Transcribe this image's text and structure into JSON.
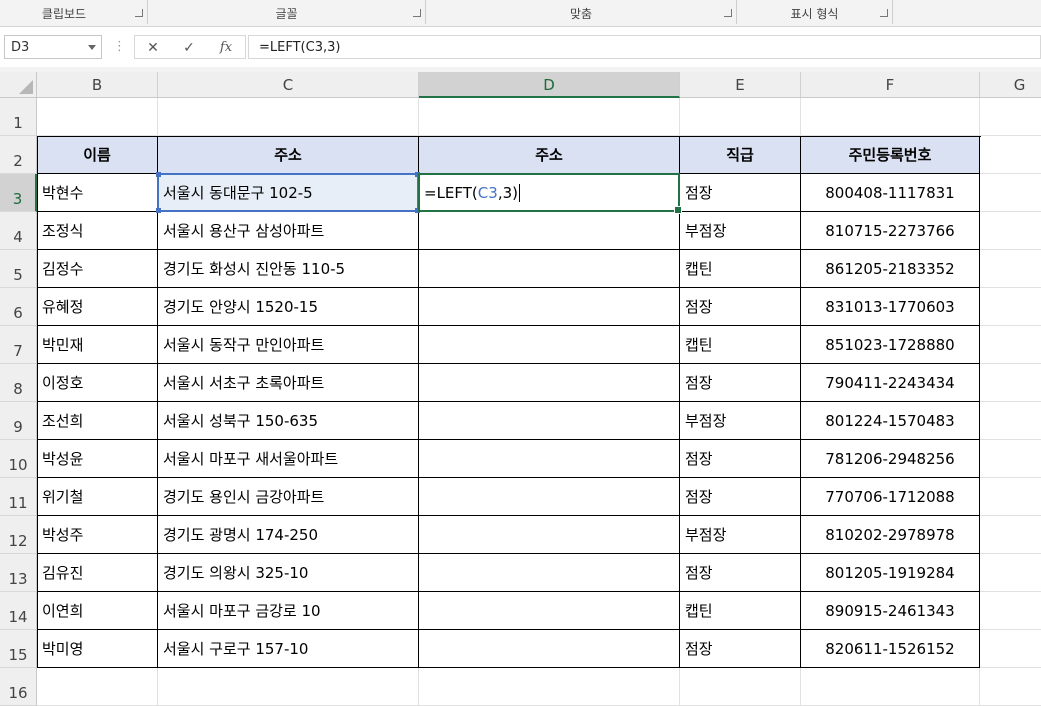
{
  "ribbon": {
    "groups": [
      "클립보드",
      "글꼴",
      "맞춤",
      "표시 형식"
    ]
  },
  "formula_bar": {
    "name_box": "D3",
    "cancel_icon": "✕",
    "enter_icon": "✓",
    "fx_label": "fx",
    "formula": "=LEFT(C3,3)"
  },
  "columns": [
    "B",
    "C",
    "D",
    "E",
    "F",
    "G"
  ],
  "rows": [
    "1",
    "2",
    "3",
    "4",
    "5",
    "6",
    "7",
    "8",
    "9",
    "10",
    "11",
    "12",
    "13",
    "14",
    "15",
    "16"
  ],
  "table": {
    "headers": [
      "이름",
      "주소",
      "주소",
      "직급",
      "주민등록번호"
    ],
    "records": [
      {
        "name": "박현수",
        "address": "서울시 동대문구 102-5",
        "result": "",
        "rank": "점장",
        "id": "800408-1117831"
      },
      {
        "name": "조정식",
        "address": "서울시 용산구 삼성아파트",
        "result": "",
        "rank": "부점장",
        "id": "810715-2273766"
      },
      {
        "name": "김정수",
        "address": "경기도 화성시 진안동 110-5",
        "result": "",
        "rank": "캡틴",
        "id": "861205-2183352"
      },
      {
        "name": "유혜정",
        "address": "경기도 안양시 1520-15",
        "result": "",
        "rank": "점장",
        "id": "831013-1770603"
      },
      {
        "name": "박민재",
        "address": "서울시 동작구 만인아파트",
        "result": "",
        "rank": "캡틴",
        "id": "851023-1728880"
      },
      {
        "name": "이정호",
        "address": "서울시 서초구 초록아파트",
        "result": "",
        "rank": "점장",
        "id": "790411-2243434"
      },
      {
        "name": "조선희",
        "address": "서울시 성북구 150-635",
        "result": "",
        "rank": "부점장",
        "id": "801224-1570483"
      },
      {
        "name": "박성윤",
        "address": "서울시 마포구 새서울아파트",
        "result": "",
        "rank": "점장",
        "id": "781206-2948256"
      },
      {
        "name": "위기철",
        "address": "경기도 용인시 금강아파트",
        "result": "",
        "rank": "점장",
        "id": "770706-1712088"
      },
      {
        "name": "박성주",
        "address": "경기도 광명시 174-250",
        "result": "",
        "rank": "부점장",
        "id": "810202-2978978"
      },
      {
        "name": "김유진",
        "address": "경기도 의왕시 325-10",
        "result": "",
        "rank": "점장",
        "id": "801205-1919284"
      },
      {
        "name": "이연희",
        "address": "서울시 마포구 금강로 10",
        "result": "",
        "rank": "캡틴",
        "id": "890915-2461343"
      },
      {
        "name": "박미영",
        "address": "서울시 구로구 157-10",
        "result": "",
        "rank": "점장",
        "id": "820611-1526152"
      }
    ]
  },
  "editing": {
    "cell": "D3",
    "prefix": "=LEFT(",
    "ref": "C3",
    "suffix": ",3)"
  }
}
